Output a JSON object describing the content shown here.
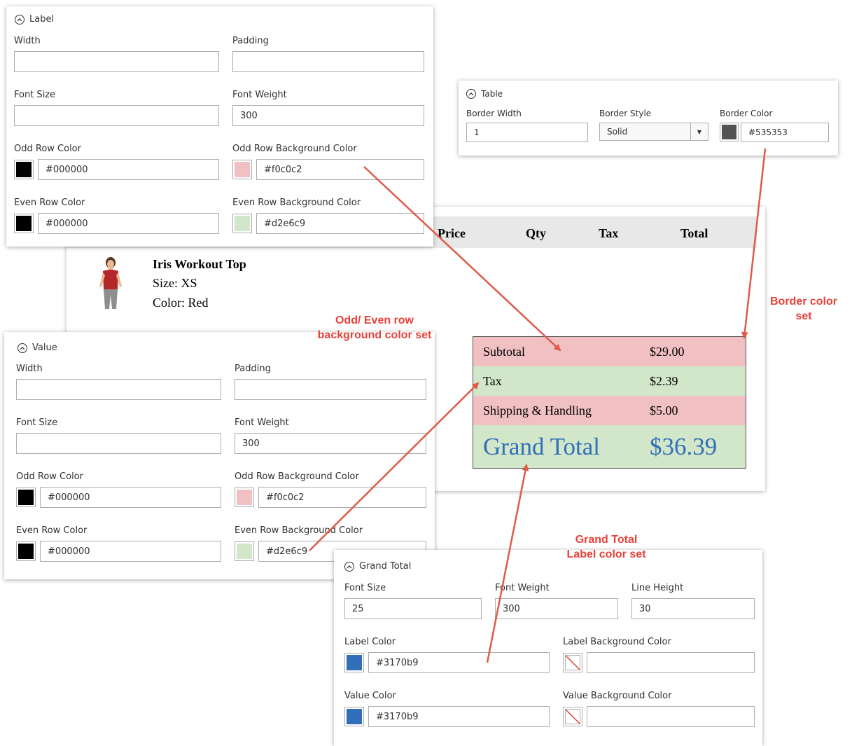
{
  "label_panel": {
    "title": "Label",
    "width_label": "Width",
    "width_value": "",
    "padding_label": "Padding",
    "padding_value": "",
    "font_size_label": "Font Size",
    "font_size_value": "",
    "font_weight_label": "Font Weight",
    "font_weight_value": "300",
    "odd_row_color_label": "Odd Row Color",
    "odd_row_color": "#000000",
    "odd_row_bg_label": "Odd Row Background Color",
    "odd_row_bg": "#f0c0c2",
    "even_row_color_label": "Even Row Color",
    "even_row_color": "#000000",
    "even_row_bg_label": "Even Row Background Color",
    "even_row_bg": "#d2e6c9"
  },
  "table_panel": {
    "title": "Table",
    "border_width_label": "Border Width",
    "border_width_value": "1",
    "border_style_label": "Border Style",
    "border_style_value": "Solid",
    "border_color_label": "Border Color",
    "border_color": "#535353"
  },
  "invoice": {
    "headers": [
      "Price",
      "Qty",
      "Tax",
      "Total"
    ],
    "product_name": "Iris Workout Top",
    "product_size": "Size: XS",
    "product_color": "Color: Red",
    "totals": [
      {
        "label": "Subtotal",
        "value": "$29.00"
      },
      {
        "label": "Tax",
        "value": "$2.39"
      },
      {
        "label": "Shipping & Handling",
        "value": "$5.00"
      },
      {
        "label": "Grand Total",
        "value": "$36.39"
      }
    ]
  },
  "value_panel": {
    "title": "Value",
    "width_label": "Width",
    "width_value": "",
    "padding_label": "Padding",
    "padding_value": "",
    "font_size_label": "Font Size",
    "font_size_value": "",
    "font_weight_label": "Font Weight",
    "font_weight_value": "300",
    "odd_row_color_label": "Odd Row Color",
    "odd_row_color": "#000000",
    "odd_row_bg_label": "Odd Row Background Color",
    "odd_row_bg": "#f0c0c2",
    "even_row_color_label": "Even Row Color",
    "even_row_color": "#000000",
    "even_row_bg_label": "Even Row Background Color",
    "even_row_bg": "#d2e6c9"
  },
  "grand_total_panel": {
    "title": "Grand Total",
    "font_size_label": "Font Size",
    "font_size_value": "25",
    "font_weight_label": "Font Weight",
    "font_weight_value": "300",
    "line_height_label": "Line Height",
    "line_height_value": "30",
    "label_color_label": "Label Color",
    "label_color": "#3170b9",
    "label_bg_label": "Label Background Color",
    "label_bg": "",
    "value_color_label": "Value Color",
    "value_color": "#3170b9",
    "value_bg_label": "Value Background Color",
    "value_bg": ""
  },
  "annotations": {
    "row_bg": "Odd/ Even row\nbackground color set",
    "border": "Border color\nset",
    "grand_total": "Grand Total\nLabel color set"
  },
  "colors": {
    "odd_row_bg": "#f0c0c2",
    "even_row_bg": "#d2e6c9",
    "border": "#535353",
    "grand_total": "#3170b9",
    "arrow": "#e05a4a",
    "header_bg": "#e8e8e8"
  }
}
